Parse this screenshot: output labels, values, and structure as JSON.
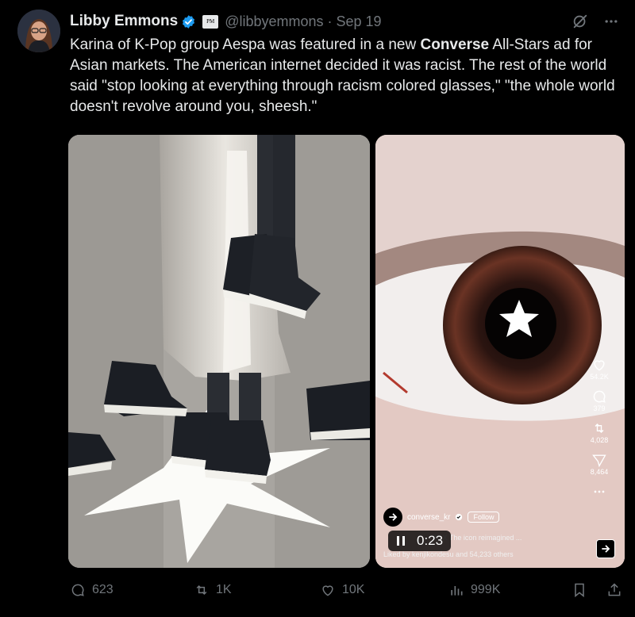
{
  "author": {
    "name": "Libby Emmons",
    "handle": "@libbyemmons",
    "separator": "·",
    "date": "Sep 19",
    "affiliate_badge": "PM",
    "verified_color": "#1d9bf0"
  },
  "tweet": {
    "text_before": "Karina of K-Pop group Aespa was featured in a new ",
    "text_bold": "Converse",
    "text_after": " All-Stars ad for Asian markets. The American internet decided it was racist. The rest of the world said \"stop looking at everything through racism colored glasses,\" \"the whole world doesn't revolve around you, sheesh.\""
  },
  "video": {
    "likes": "54.2K",
    "comments": "379",
    "shares": "4,028",
    "sends": "8,464",
    "account": "converse_kr",
    "follow_label": "Follow",
    "caption": "70 X  The icon reimagined ...",
    "caption2": "Liked by kenjikondesu and 54,233 others",
    "time": "0:23"
  },
  "actions": {
    "replies": "623",
    "reposts": "1K",
    "likes": "10K",
    "views": "999K"
  }
}
